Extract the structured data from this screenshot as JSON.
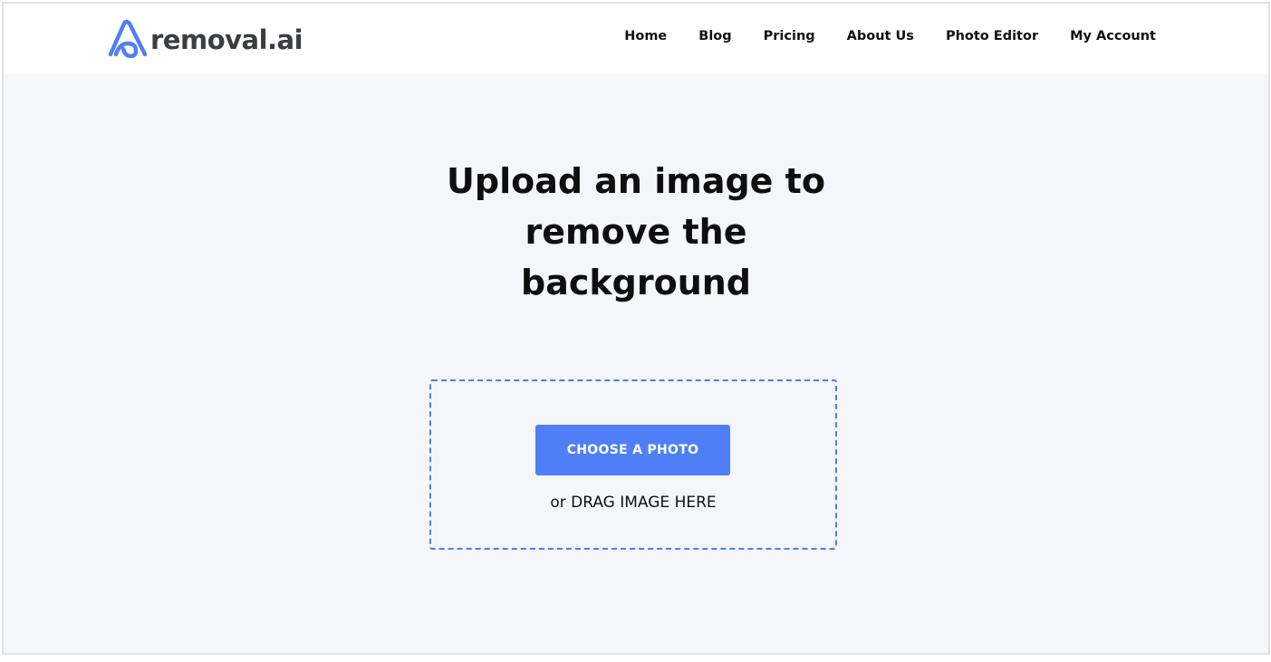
{
  "brand": {
    "name": "removal.ai",
    "logo_icon": "removal-ai-logo-icon",
    "accent_color": "#4f7ff6",
    "text_color": "#3b3d42"
  },
  "nav": {
    "items": [
      {
        "label": "Home"
      },
      {
        "label": "Blog"
      },
      {
        "label": "Pricing"
      },
      {
        "label": "About Us"
      },
      {
        "label": "Photo Editor"
      },
      {
        "label": "My Account"
      }
    ]
  },
  "main": {
    "headline": "Upload an image to remove the background",
    "upload": {
      "button_label": "CHOOSE A PHOTO",
      "drag_hint": "or DRAG IMAGE HERE",
      "border_color": "#4c7df2"
    },
    "background_color": "#f4f6f9"
  }
}
